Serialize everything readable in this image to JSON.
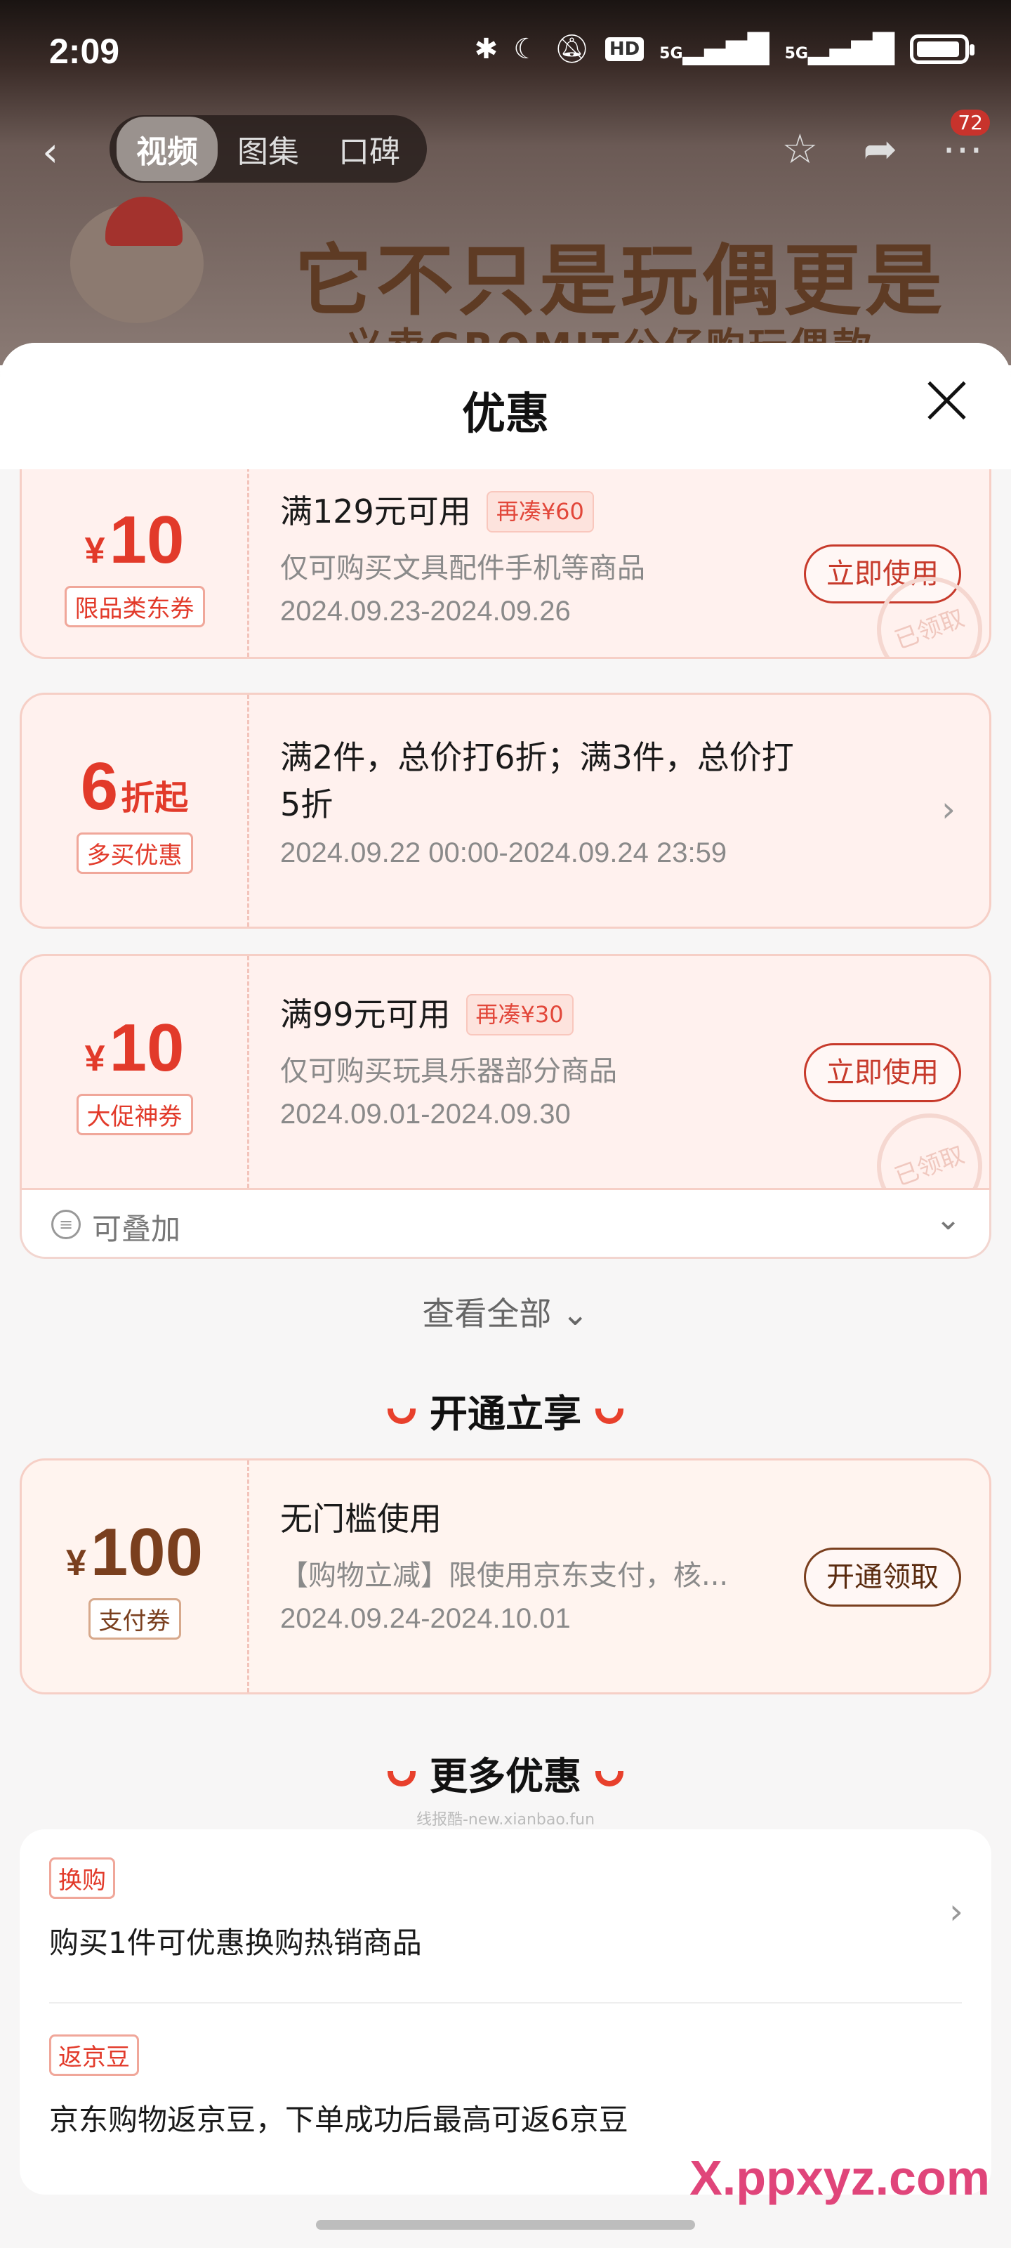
{
  "status": {
    "time": "2:09",
    "net1": "5G",
    "net2": "5G",
    "hd": "HD"
  },
  "nav": {
    "tabs": [
      "视频",
      "图集",
      "口碑"
    ],
    "badge": "72"
  },
  "banner": {
    "headline": "它不只是玩偶更是陪伴",
    "sub": "义卖GROMIT公仔购玩偶款"
  },
  "sheet": {
    "title": "优惠"
  },
  "coupons": [
    {
      "currency": "¥",
      "amount": "10",
      "suffix": "",
      "tag": "限品类东券",
      "title": "满129元可用",
      "extra": "再凑¥60",
      "desc": "仅可购买文具配件手机等商品",
      "date": "2024.09.23-2024.09.26",
      "button": "立即使用",
      "stamp": "已领取"
    },
    {
      "currency": "",
      "amount": "6",
      "suffix": "折起",
      "tag": "多买优惠",
      "title_line1": "满2件，总价打6折；满3件，总价打",
      "title_line2": "5折",
      "date": "2024.09.22 00:00-2024.09.24 23:59"
    },
    {
      "currency": "¥",
      "amount": "10",
      "suffix": "",
      "tag": "大促神券",
      "title": "满99元可用",
      "extra": "再凑¥30",
      "desc": "仅可购买玩具乐器部分商品",
      "date": "2024.09.01-2024.09.30",
      "button": "立即使用",
      "stamp": "已领取"
    }
  ],
  "stackable": {
    "label": "可叠加"
  },
  "view_all": "查看全部",
  "section_open": {
    "title": "开通立享"
  },
  "open_coupon": {
    "currency": "¥",
    "amount": "100",
    "tag": "支付券",
    "title": "无门槛使用",
    "desc": "【购物立减】限使用京东支付，核...",
    "date": "2024.09.24-2024.10.01",
    "button": "开通领取"
  },
  "section_more": {
    "title": "更多优惠"
  },
  "watermark": "线报酷-new.xianbao.fun",
  "more": [
    {
      "tag": "换购",
      "text": "购买1件可优惠换购热销商品"
    },
    {
      "tag": "返京豆",
      "text": "京东购物返京豆，下单成功后最高可返6京豆"
    }
  ],
  "brand": "X.ppxyz.com",
  "colors": {
    "accent": "#e23a2a",
    "coupon_bg": "#fff1ee",
    "sheet_bg": "#f7f6f6"
  }
}
